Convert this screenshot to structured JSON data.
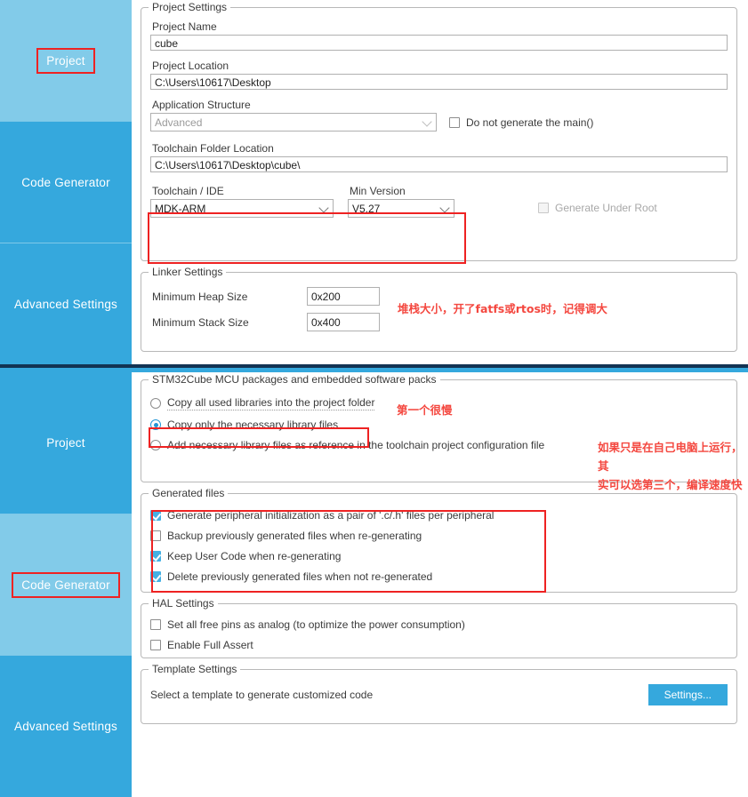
{
  "sidebar": {
    "items": [
      "Project",
      "Code Generator",
      "Advanced Settings"
    ]
  },
  "project_panel": {
    "project_settings": {
      "title": "Project Settings",
      "project_name_label": "Project Name",
      "project_name_value": "cube",
      "project_location_label": "Project Location",
      "project_location_value": "C:\\Users\\10617\\Desktop",
      "application_structure_label": "Application Structure",
      "application_structure_value": "Advanced",
      "do_not_generate_main_label": "Do not generate the main()",
      "do_not_generate_main_checked": false,
      "toolchain_folder_label": "Toolchain Folder Location",
      "toolchain_folder_value": "C:\\Users\\10617\\Desktop\\cube\\",
      "toolchain_ide_label": "Toolchain / IDE",
      "toolchain_ide_value": "MDK-ARM",
      "min_version_label": "Min Version",
      "min_version_value": "V5.27",
      "generate_under_root_label": "Generate Under Root",
      "generate_under_root_checked": false
    },
    "linker_settings": {
      "title": "Linker Settings",
      "heap_label": "Minimum Heap Size",
      "heap_value": "0x200",
      "stack_label": "Minimum Stack Size",
      "stack_value": "0x400"
    },
    "annotation_stack": "堆栈大小，开了fatfs或rtos时，记得调大"
  },
  "codegen_panel": {
    "packages": {
      "title": "STM32Cube MCU packages and embedded software packs",
      "options": [
        "Copy all used libraries into the project folder",
        "Copy only the necessary library files",
        "Add necessary library files as reference in the toolchain project configuration file"
      ],
      "selected_index": 1
    },
    "generated_files": {
      "title": "Generated files",
      "items": [
        {
          "label": "Generate peripheral initialization as a pair of '.c/.h' files per peripheral",
          "checked": true
        },
        {
          "label": "Backup previously generated files when re-generating",
          "checked": false
        },
        {
          "label": "Keep User Code when re-generating",
          "checked": true
        },
        {
          "label": "Delete previously generated files when not re-generated",
          "checked": true
        }
      ]
    },
    "hal_settings": {
      "title": "HAL Settings",
      "items": [
        {
          "label": "Set all free pins as analog (to optimize the power consumption)",
          "checked": false
        },
        {
          "label": "Enable Full Assert",
          "checked": false
        }
      ]
    },
    "template_settings": {
      "title": "Template Settings",
      "description": "Select a template to generate customized code",
      "button_label": "Settings..."
    },
    "annotation_first_slow": "第一个很慢",
    "annotation_third_option": "如果只是在自己电脑上运行，其\n实可以选第三个，编译速度快"
  },
  "colors": {
    "accent": "#35a8dd",
    "accent_selected": "#82cbe9",
    "annotation_red": "#f4473f",
    "highlight_box": "#ee2222",
    "divider_dark": "#123353"
  }
}
